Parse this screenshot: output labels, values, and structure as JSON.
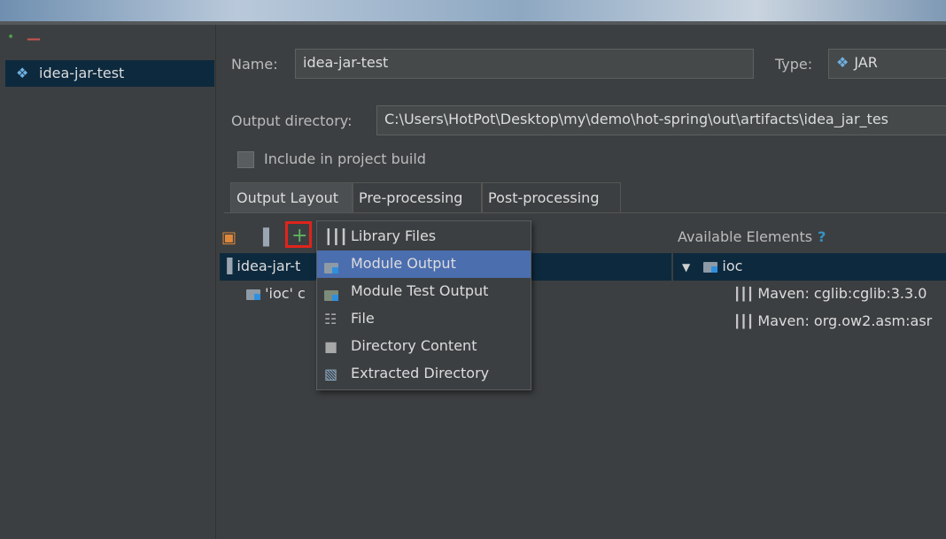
{
  "left_panel": {
    "artifacts": [
      "idea-jar-test"
    ]
  },
  "form": {
    "name_label": "Name:",
    "name_value": "idea-jar-test",
    "type_label": "Type:",
    "type_value": "JAR",
    "output_dir_label": "Output directory:",
    "output_dir_value": "C:\\Users\\HotPot\\Desktop\\my\\demo\\hot-spring\\out\\artifacts\\idea_jar_tes",
    "include_label": "Include in project build",
    "include_checked": false
  },
  "tabs": [
    {
      "label": "Output Layout",
      "active": true
    },
    {
      "label": "Pre-processing",
      "active": false
    },
    {
      "label": "Post-processing",
      "active": false
    }
  ],
  "layout_tree": [
    {
      "label": "idea-jar-t",
      "icon": "jar-icon",
      "selected": true
    },
    {
      "label": "'ioc' c",
      "icon": "module-folder-icon",
      "selected": false
    }
  ],
  "add_menu": {
    "items": [
      {
        "label": "Library Files",
        "icon": "library-icon",
        "highlighted": false
      },
      {
        "label": "Module Output",
        "icon": "module-folder-icon",
        "highlighted": true
      },
      {
        "label": "Module Test Output",
        "icon": "test-folder-icon",
        "highlighted": false
      },
      {
        "label": "File",
        "icon": "file-icon",
        "highlighted": false
      },
      {
        "label": "Directory Content",
        "icon": "folder-icon",
        "highlighted": false
      },
      {
        "label": "Extracted Directory",
        "icon": "extracted-directory-icon",
        "highlighted": false
      }
    ]
  },
  "available": {
    "header": "Available Elements",
    "help": "?",
    "tree": [
      {
        "label": "ioc",
        "icon": "module-folder-icon",
        "expanded": true
      },
      {
        "label": "Maven: cglib:cglib:3.3.0",
        "icon": "library-icon"
      },
      {
        "label": "Maven: org.ow2.asm:asr",
        "icon": "library-icon"
      }
    ]
  },
  "colors": {
    "background": "#3c3f41",
    "selection": "#0d293e",
    "menu_highlight": "#4b6eaf",
    "highlight_box": "#e0241b"
  }
}
